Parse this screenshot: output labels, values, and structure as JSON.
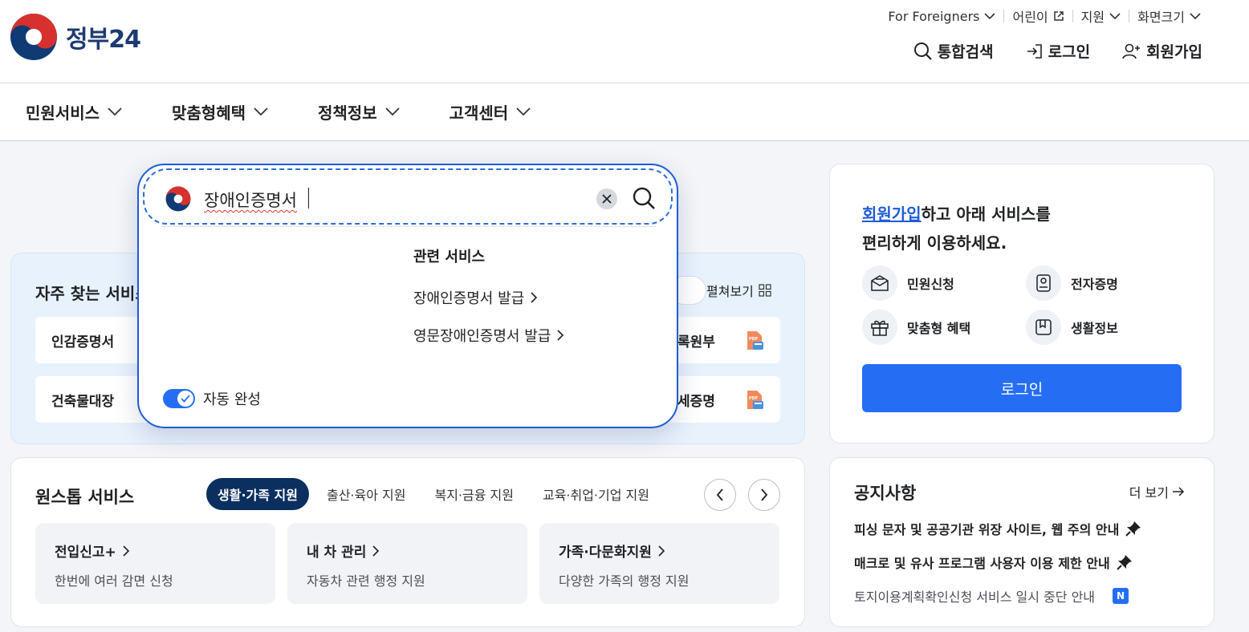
{
  "header": {
    "logo_text": "정부24",
    "utility": [
      {
        "label": "For Foreigners",
        "icon": "chevron-down-icon"
      },
      {
        "label": "어린이",
        "icon": "external-link-icon"
      },
      {
        "label": "지원",
        "icon": "chevron-down-icon"
      },
      {
        "label": "화면크기",
        "icon": "chevron-down-icon"
      }
    ],
    "actions": {
      "search": "통합검색",
      "login": "로그인",
      "signup": "회원가입"
    }
  },
  "nav": {
    "items": [
      "민원서비스",
      "맞춤형혜택",
      "정책정보",
      "고객센터"
    ]
  },
  "search_popup": {
    "query": "장애인증명서",
    "related_heading": "관련 서비스",
    "related_links": [
      "장애인증명서 발급",
      "영문장애인증명서 발급"
    ],
    "autocomplete_label": "자동 완성",
    "autocomplete_on": true
  },
  "frequent": {
    "title": "자주 찾는 서비스",
    "expand_label": "펼쳐보기",
    "tiles_left": [
      "인감증명서",
      "건축물대장"
    ],
    "tiles_right": [
      "록원부",
      "세증명"
    ]
  },
  "onestop": {
    "title": "원스톱 서비스",
    "tabs": [
      "생활·가족 지원",
      "출산·육아 지원",
      "복지·금융 지원",
      "교육·취업·기업 지원"
    ],
    "active_tab": 0,
    "cards": [
      {
        "title": "전입신고+",
        "desc": "한번에 여러 감면 신청"
      },
      {
        "title": "내 차 관리",
        "desc": "자동차 관련 행정 지원"
      },
      {
        "title": "가족·다문화지원",
        "desc": "다양한 가족의 행정 지원"
      }
    ]
  },
  "login_card": {
    "link_text": "회원가입",
    "msg_line1_rest": "하고 아래 서비스를",
    "msg_line2": "편리하게 이용하세요.",
    "quick_items": [
      {
        "label": "민원신청",
        "icon": "envelope-icon"
      },
      {
        "label": "전자증명",
        "icon": "certificate-icon"
      },
      {
        "label": "맞춤형 혜택",
        "icon": "gift-icon"
      },
      {
        "label": "생활정보",
        "icon": "bookmark-icon"
      }
    ],
    "login_button": "로그인"
  },
  "notice": {
    "title": "공지사항",
    "more_label": "더 보기",
    "items": [
      {
        "text": "피싱 문자 및 공공기관 위장 사이트, 웹 주의 안내",
        "pinned": true
      },
      {
        "text": "매크로 및 유사 프로그램 사용자 이용 제한 안내",
        "pinned": true
      },
      {
        "text": "토지이용계획확인신청 서비스 일시 중단 안내",
        "badge": "N"
      }
    ]
  },
  "colors": {
    "primary": "#256ef4",
    "navy": "#0b2f5e",
    "link": "#1f5bd6"
  }
}
